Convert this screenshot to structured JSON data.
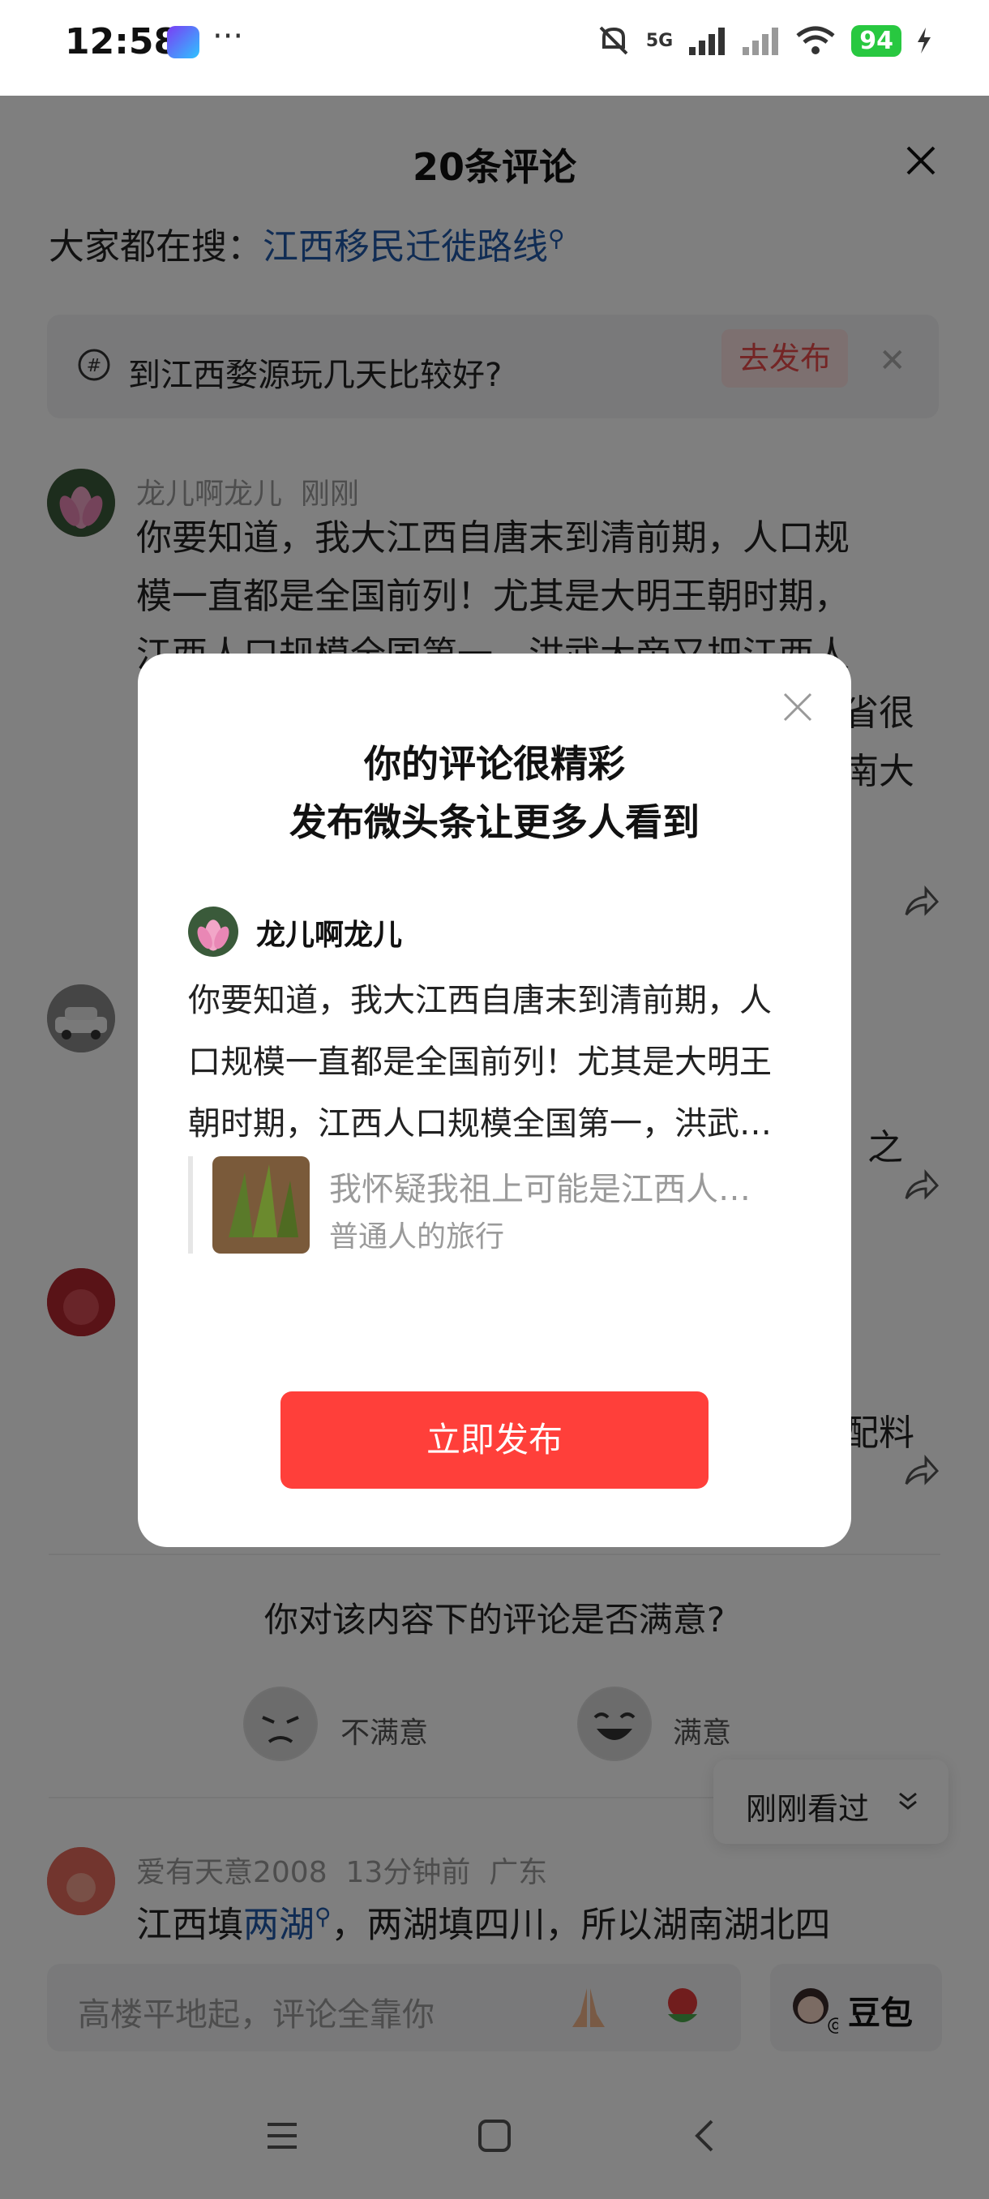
{
  "status": {
    "time": "12:58",
    "more": "···",
    "network": "5G",
    "battery": "94"
  },
  "sheet": {
    "title": "20条评论",
    "search_prefix": "大家都在搜：",
    "search_term": "江西移民迁徙路线",
    "topic_text": "到江西婺源玩几天比较好?",
    "topic_button": "去发布"
  },
  "comments": [
    {
      "user": "龙儿啊龙儿",
      "time": "刚刚",
      "lines": [
        "你要知道，我大江西自唐末到清前期，人口规",
        "模一直都是全国前列！尤其是大明王朝时期，",
        "江西人口规模全国第一，洪武大帝又把江西人"
      ],
      "tail_right_1": "省很",
      "tail_right_2": "南大"
    },
    {
      "tail_right": "之"
    },
    {
      "tail_right": "配料"
    }
  ],
  "survey": {
    "question": "你对该内容下的评论是否满意?",
    "bad": "不满意",
    "good": "满意"
  },
  "recent": {
    "label": "刚刚看过"
  },
  "last_comment": {
    "user": "爱有天意2008",
    "time": "13分钟前",
    "location": "广东",
    "text_a": "江西填",
    "text_link": "两湖",
    "text_b": "，两湖填四川，所以湖南湖北四"
  },
  "input": {
    "placeholder": "高楼平地起，评论全靠你",
    "doubao": "豆包"
  },
  "dialog": {
    "title_line1": "你的评论很精彩",
    "title_line2": "发布微头条让更多人看到",
    "user": "龙儿啊龙儿",
    "body_line1": "你要知道，我大江西自唐末到清前期，人",
    "body_line2": "口规模一直都是全国前列！尤其是大明王",
    "body_line3": "朝时期，江西人口规模全国第一，洪武…",
    "quote_title": "我怀疑我祖上可能是江西人…",
    "quote_sub": "普通人的旅行",
    "publish": "立即发布"
  }
}
